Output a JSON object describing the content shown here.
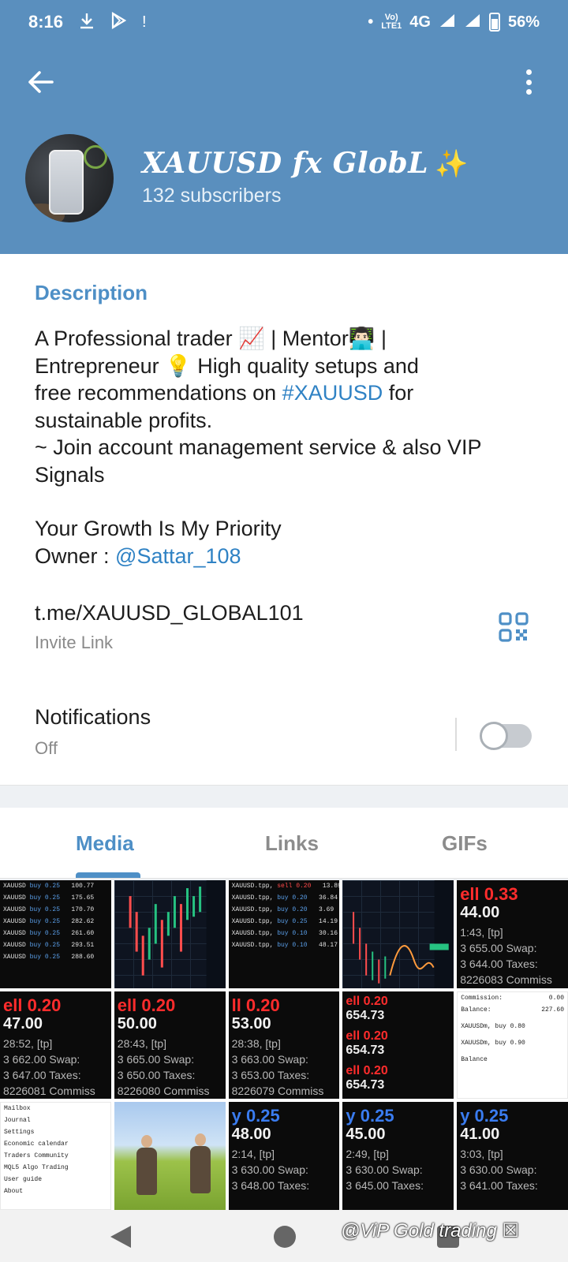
{
  "status_bar": {
    "time": "8:16",
    "left_icons": [
      "download-icon",
      "play-store-icon",
      "alert-icon"
    ],
    "alert": "!",
    "volte": "Vo)\nLTE1",
    "network": "4G",
    "battery": "56%"
  },
  "header": {
    "title": "XAUUSD fx GlobL",
    "title_emoji": "✨",
    "subscribers": "132 subscribers",
    "color": "#5a8fbe"
  },
  "description": {
    "label": "Description",
    "line1_a": "A Professional trader ",
    "emoji_chart": "📈",
    "line1_b": " | Mentor",
    "emoji_person": "👨🏻‍💻",
    "line1_c": " |",
    "line2_a": "Entrepreneur ",
    "emoji_bulb": "💡",
    "line2_b": " High quality setups and",
    "line3_a": "free recommendations on ",
    "hashtag": "#XAUUSD",
    "line3_b": " for",
    "line4": "sustainable profits.",
    "line5": "~ Join account management service & also VIP",
    "line6": "Signals",
    "line7": "Your Growth Is My Priority",
    "owner_prefix": "Owner : ",
    "owner_handle": "@Sattar_108"
  },
  "invite": {
    "link": "t.me/XAUUSD_GLOBAL101",
    "caption": "Invite Link"
  },
  "notifications": {
    "label": "Notifications",
    "value": "Off",
    "enabled": false
  },
  "tabs": [
    {
      "label": "Media",
      "active": true
    },
    {
      "label": "Links",
      "active": false
    },
    {
      "label": "GIFs",
      "active": false
    }
  ],
  "media": {
    "row2": [
      {
        "l1": "ell 0.20",
        "l2": "47.00",
        "l3": "28:52, [tp]",
        "l4": "3 662.00  Swap:",
        "l5": "3 647.00  Taxes:",
        "l6": "8226081  Commiss"
      },
      {
        "l1": "ell 0.20",
        "l2": "50.00",
        "l3": "28:43, [tp]",
        "l4": "3 665.00  Swap:",
        "l5": "3 650.00  Taxes:",
        "l6": "8226080  Commiss"
      },
      {
        "l1": "ll 0.20",
        "l2": "53.00",
        "l3": "28:38, [tp]",
        "l4": "3 663.00  Swap:",
        "l5": "3 653.00  Taxes:",
        "l6": "8226079  Commiss"
      }
    ],
    "row1_last": {
      "l1": "ell 0.33",
      "l2": "44.00",
      "l3": "1:43, [tp]",
      "l4": "3 655.00  Swap:",
      "l5": "3 644.00  Taxes:",
      "l6": "8226083  Commiss"
    },
    "sell_stack": [
      "ell 0.20",
      "654.73",
      "ell 0.20",
      "654.73",
      "ell 0.20",
      "654.73"
    ],
    "row3": [
      {
        "l1": "y 0.25",
        "l2": "48.00",
        "l3": "2:14, [tp]",
        "l4": "3 630.00  Swap:",
        "l5": "3 648.00  Taxes:"
      },
      {
        "l1": "y 0.25",
        "l2": "45.00",
        "l3": "2:49, [tp]",
        "l4": "3 630.00  Swap:",
        "l5": "3 645.00  Taxes:"
      },
      {
        "l1": "y 0.25",
        "l2": "41.00",
        "l3": "3:03, [tp]",
        "l4": "3 630.00  Swap:",
        "l5": "3 641.00  Taxes:"
      }
    ],
    "menu_items": [
      "Mailbox",
      "Journal",
      "Settings",
      "Economic calendar",
      "Traders Community",
      "MQL5 Algo Trading",
      "User guide",
      "About"
    ],
    "balance_labels": [
      "Commission:",
      "Balance:",
      "XAUUSDm, buy 0.80",
      "XAUUSDm, buy 0.90",
      "Balance"
    ],
    "balance_values": [
      "0.00",
      "227.60"
    ]
  },
  "watermark": "@ViP Gold trading ☒",
  "nav": [
    "back",
    "home",
    "recents"
  ]
}
